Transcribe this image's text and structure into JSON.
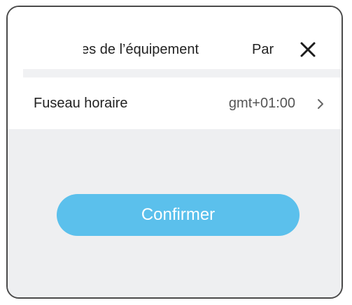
{
  "header": {
    "title": "Paramètres de l’équipement",
    "tab_label": "Paramètres",
    "close_icon": "close-icon"
  },
  "settings": {
    "timezone": {
      "label": "Fuseau horaire",
      "value": "gmt+01:00",
      "chevron_icon": "chevron-right-icon"
    }
  },
  "footer": {
    "confirm_label": "Confirmer"
  },
  "colors": {
    "accent": "#5bc0ec",
    "background": "#eeeff1",
    "frame_border": "#4a4a4a"
  }
}
